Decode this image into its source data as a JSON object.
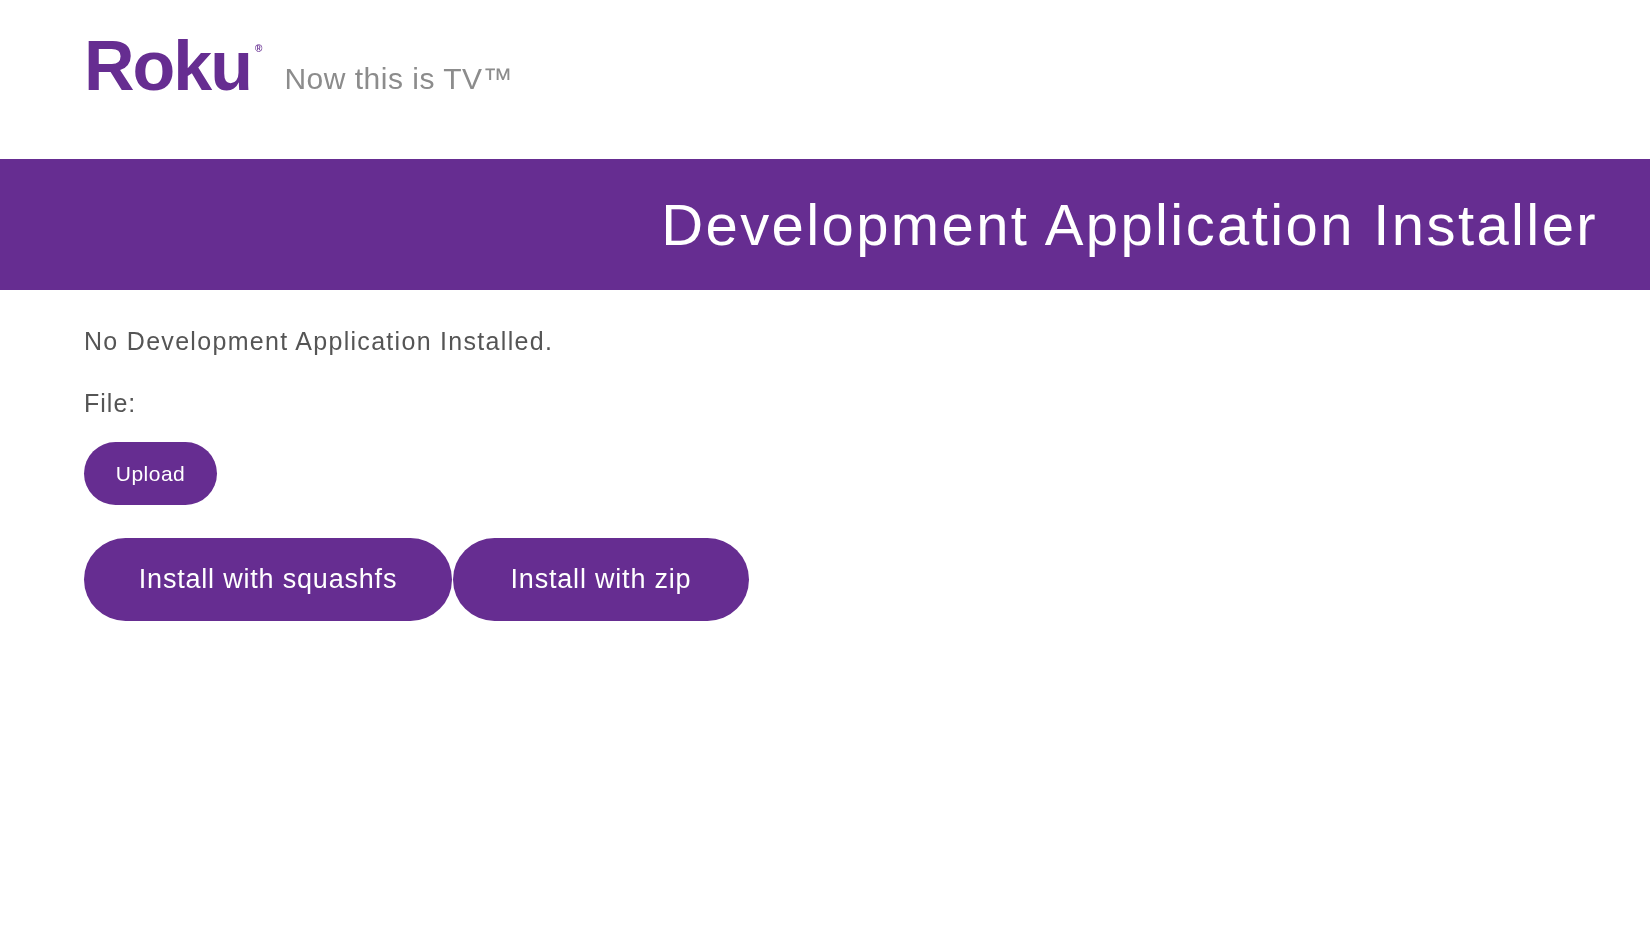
{
  "header": {
    "logo": {
      "text": "Roku",
      "mark": "®"
    },
    "tagline": "Now this is TV™"
  },
  "banner": {
    "title": "Development Application Installer"
  },
  "content": {
    "status": "No Development Application Installed.",
    "file_label": "File:",
    "upload_button": "Upload",
    "install_buttons": [
      "Install with squashfs",
      "Install with zip"
    ]
  }
}
